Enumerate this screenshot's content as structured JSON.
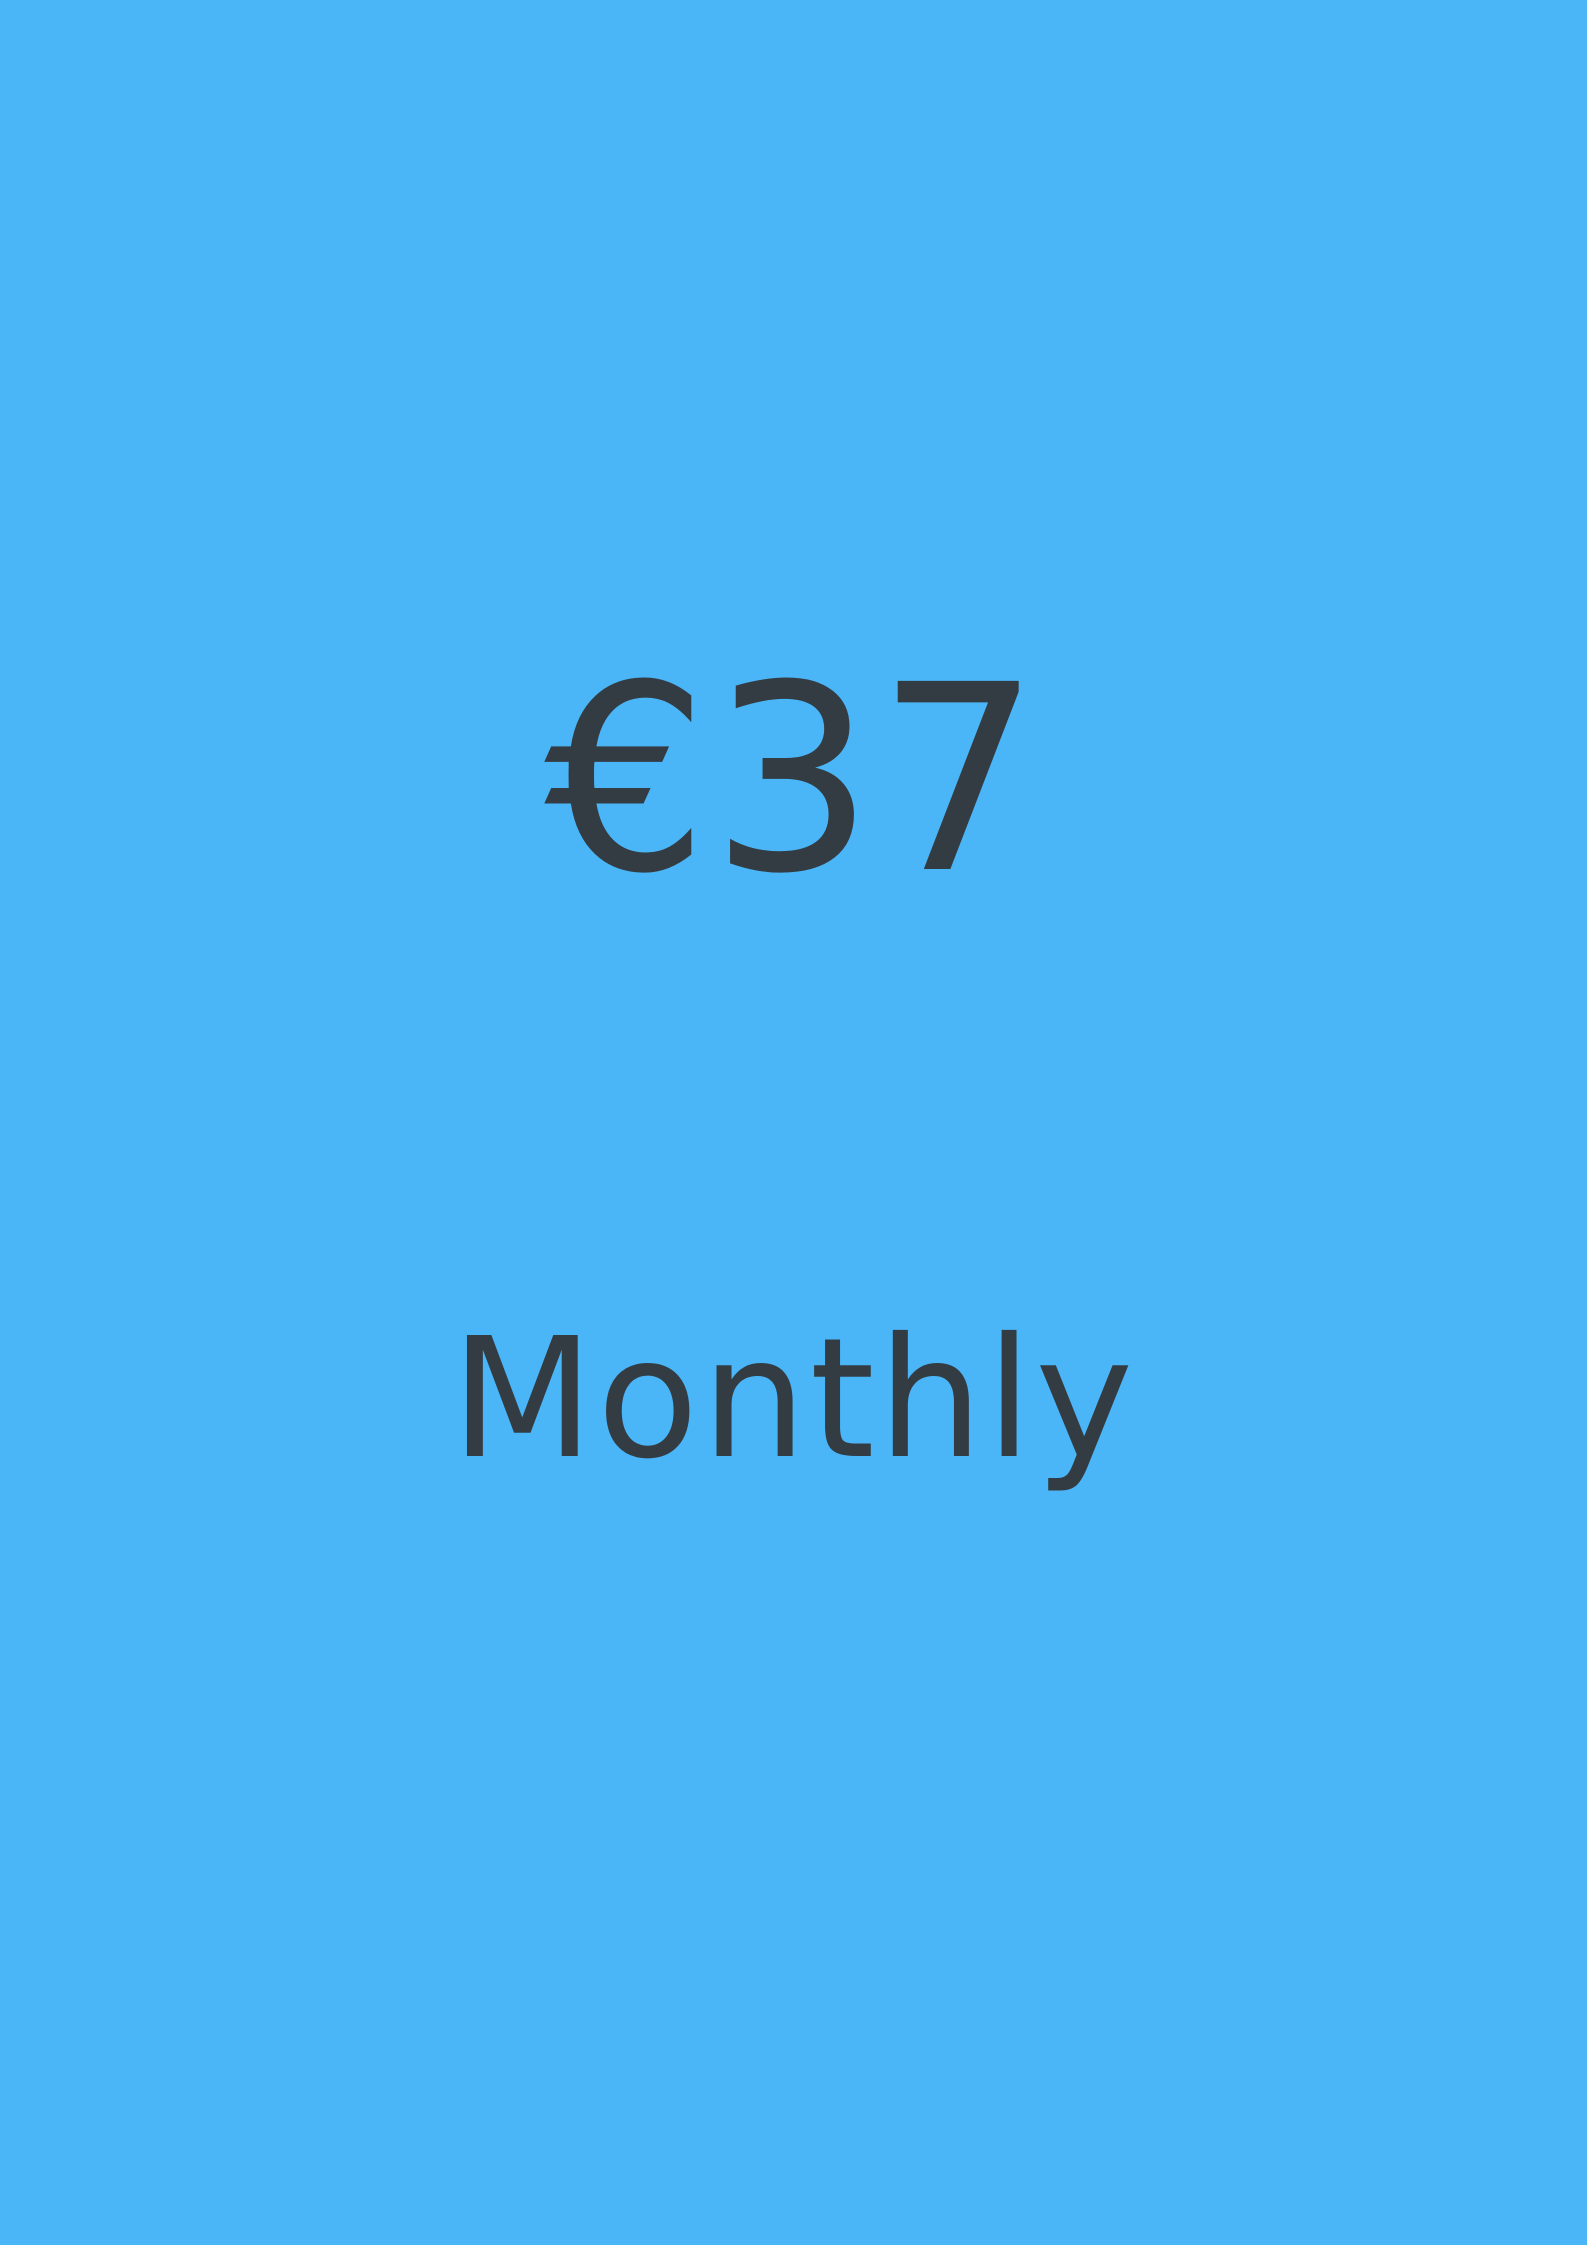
{
  "card": {
    "background_color": "#4ab6f8",
    "text_color": "#343c43",
    "price": "€37",
    "period": "Monthly"
  }
}
